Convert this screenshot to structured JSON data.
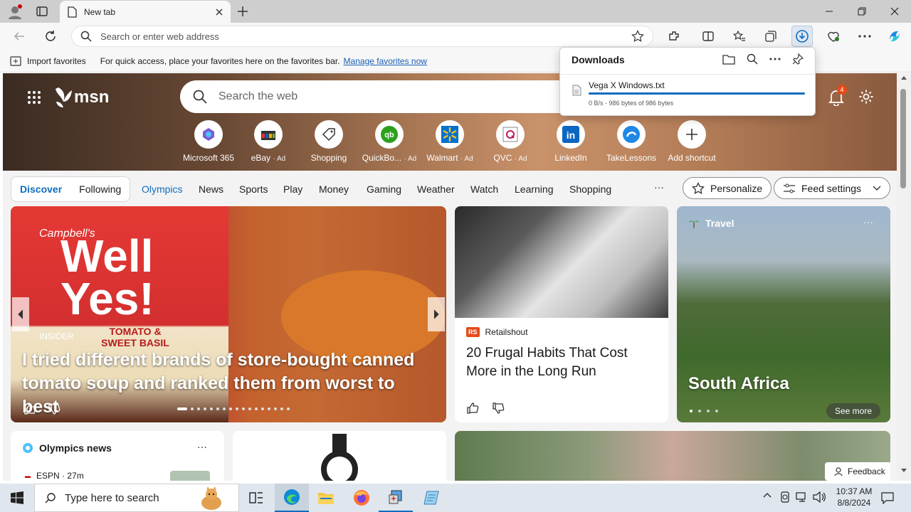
{
  "browser": {
    "tab_title": "New tab",
    "address_placeholder": "Search or enter web address",
    "favorites_import": "Import favorites",
    "favorites_hint": "For quick access, place your favorites here on the favorites bar.",
    "favorites_manage": "Manage favorites now"
  },
  "downloads": {
    "title": "Downloads",
    "file_name": "Vega X Windows.txt",
    "file_status": "0 B/s - 986 bytes of 986 bytes",
    "progress": 1.0
  },
  "msn": {
    "logo": "msn",
    "search_placeholder": "Search the web",
    "notification_count": "4",
    "shortcuts": [
      {
        "label": "Microsoft 365",
        "ad": ""
      },
      {
        "label": "eBay",
        "ad": "· Ad"
      },
      {
        "label": "Shopping",
        "ad": ""
      },
      {
        "label": "QuickBo...",
        "ad": "· Ad"
      },
      {
        "label": "Walmart",
        "ad": "· Ad"
      },
      {
        "label": "QVC",
        "ad": "· Ad"
      },
      {
        "label": "LinkedIn",
        "ad": ""
      },
      {
        "label": "TakeLessons",
        "ad": ""
      },
      {
        "label": "Add shortcut",
        "ad": ""
      }
    ],
    "feed_tabs": [
      "Discover",
      "Following"
    ],
    "nav": [
      "Olympics",
      "News",
      "Sports",
      "Play",
      "Money",
      "Gaming",
      "Weather",
      "Watch",
      "Learning",
      "Shopping"
    ],
    "more": "···",
    "personalize": "Personalize",
    "feed_settings": "Feed settings"
  },
  "cards": {
    "main": {
      "source": "INSIDER",
      "title": "I tried different brands of store-bought canned tomato soup and ranked them from worst to best"
    },
    "middle": {
      "source_badge": "RS",
      "source": "Retailshout",
      "title": "20 Frugal Habits That Cost More in the Long Run"
    },
    "travel": {
      "category": "Travel",
      "title": "South Africa",
      "see_more": "See more"
    },
    "olympics": {
      "title": "Olympics news",
      "source": "ESPN · 27m"
    },
    "feedback": "Feedback"
  },
  "can_text": {
    "brand": "Campbell's",
    "line1": "Well",
    "line2": "Yes!",
    "flavor": "TOMATO & SWEET BASIL"
  },
  "taskbar": {
    "search_placeholder": "Type here to search",
    "time": "10:37 AM",
    "date": "8/8/2024"
  },
  "colors": {
    "accent": "#0f6cbd",
    "taskbar": "#dfe6ee"
  }
}
